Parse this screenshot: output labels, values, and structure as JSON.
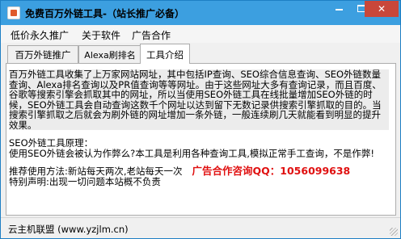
{
  "window": {
    "title": "免费百万外链工具-（站长推广必备）",
    "close_glyph": "✕"
  },
  "menu": {
    "items": [
      "低价永久推广",
      "关于软件",
      "广告合作"
    ]
  },
  "tabs": [
    {
      "label": "百万外链推广",
      "active": false
    },
    {
      "label": "Alexa刷排名",
      "active": false
    },
    {
      "label": "工具介绍",
      "active": true
    }
  ],
  "content": {
    "intro": "百万外链工具收集了上万家网站网址，其中包括IP查询、SEO综合信息查询、SEO外链数量查询、Alexa排名查询以及PR值查询等等网址。由于这些网址大多有查询记录，而且百度、谷歌等搜索引擎会抓取其中的网址，所以当使用SEO外链工具在线批量增加SEO外链的时候，SEO外链工具会自动查询这数千个网址以达到留下无数记录供搜索引擎抓取的目的。当搜索引擎抓取之后就会为刷外链的网址增加一条外链，一般连续刷几天就能看到明显的提升效果。",
    "principle_title": "SEO外链工具原理：",
    "principle_text": "使用SEO外链会被认为作弊么?本工具是利用各种查询工具,模拟正常手工查询，不是作弊!",
    "usage": "推荐使用方法:新站每天两次,老站每天一次",
    "ad": "广告合作咨询QQ：1056099638",
    "disclaimer": "特别声明:出现一切问题本站概不负责"
  },
  "status": {
    "text": "云主机联盟 (www.yzjlm.cn)"
  },
  "colors": {
    "titlebar": "#3c9fe0",
    "close_button": "#c9473a",
    "ad_text": "#e01010"
  }
}
